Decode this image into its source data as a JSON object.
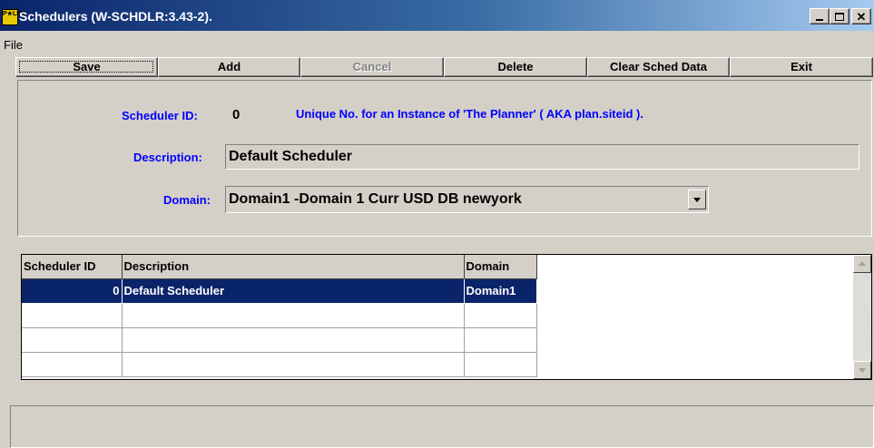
{
  "window": {
    "title": "Schedulers (W-SCHDLR:3.43-2).",
    "icon_text": "P★LEX"
  },
  "menu": {
    "file_label": "File"
  },
  "toolbar": {
    "save_label": "Save",
    "add_label": "Add",
    "cancel_label": "Cancel",
    "delete_label": "Delete",
    "clear_label": "Clear Sched Data",
    "exit_label": "Exit"
  },
  "form": {
    "scheduler_id_label": "Scheduler ID:",
    "scheduler_id_value": "0",
    "scheduler_id_note": "Unique No.  for an Instance of 'The Planner' ( AKA plan.siteid ).",
    "description_label": "Description:",
    "description_value": "Default Scheduler",
    "domain_label": "Domain:",
    "domain_value": "Domain1 -Domain 1 Curr USD DB newyork"
  },
  "grid": {
    "columns": [
      "Scheduler ID",
      "Description",
      "Domain"
    ],
    "rows": [
      [
        "0",
        "Default Scheduler",
        "Domain1"
      ],
      [
        "",
        "",
        ""
      ],
      [
        "",
        "",
        ""
      ],
      [
        "",
        "",
        ""
      ]
    ]
  },
  "colors": {
    "label_blue": "#0000ff",
    "selection": "#0a246a",
    "title_start": "#0a246a",
    "title_end": "#a6caf0"
  }
}
